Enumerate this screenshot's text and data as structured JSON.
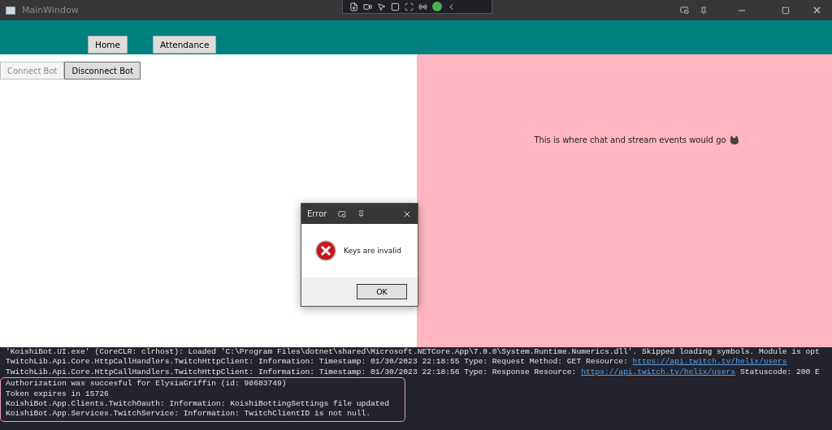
{
  "window": {
    "title": "MainWindow"
  },
  "nav_tabs": [
    {
      "label": "Home"
    },
    {
      "label": "Attendance"
    }
  ],
  "bot_buttons": [
    {
      "label": "Connect Bot",
      "disabled": true
    },
    {
      "label": "Disconnect Bot",
      "disabled": false
    }
  ],
  "chat_panel": {
    "message": "This is where chat and stream events would go"
  },
  "dialog": {
    "title": "Error",
    "message": "Keys are invalid",
    "button": "OK"
  },
  "console": {
    "lines": [
      {
        "text": "'KoishiBot.UI.exe' (CoreCLR: clrhost): Loaded 'C:\\Program Files\\dotnet\\shared\\Microsoft.NETCore.App\\7.0.0\\System.Runtime.Numerics.dll'. Skipped loading symbols. Module is opt",
        "highlighted": false
      },
      {
        "text": "TwitchLib.Api.Core.HttpCallHandlers.TwitchHttpClient: Information: Timestamp: 01/30/2023 22:18:55 Type: Request Method: GET Resource: ",
        "link": "https://api.twitch.tv/helix/users",
        "highlighted": false
      },
      {
        "text": "TwitchLib.Api.Core.HttpCallHandlers.TwitchHttpClient: Information: Timestamp: 01/30/2023 22:18:56 Type: Response Resource: ",
        "link": "https://api.twitch.tv/helix/users",
        "after": " Statuscode: 200 E",
        "highlighted": false
      },
      {
        "text": "Authorization was succesful for ElysiaGriffin (id: 98683749)",
        "highlighted": true
      },
      {
        "text": " Token expires in 15726",
        "highlighted": true
      },
      {
        "text": "KoishiBot.App.Clients.TwitchOauth: Information: KoishiBottingSettings file updated",
        "highlighted": true
      },
      {
        "text": "KoishiBot.App.Services.TwitchService: Information: TwitchClientID is not null.",
        "highlighted": true
      }
    ]
  }
}
